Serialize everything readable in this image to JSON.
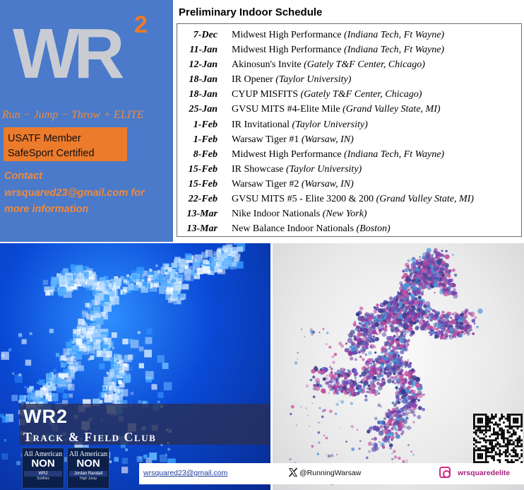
{
  "logo": {
    "letters": "WR",
    "superscript": "2"
  },
  "tagline": "Run − Jump − Throw + ELITE",
  "membership": {
    "line1": "USATF Member",
    "line2": "SafeSport Certified"
  },
  "contact": {
    "line1": "Contact",
    "line2": "wrsquared23@gmail.com for",
    "line3": "more information"
  },
  "schedule": {
    "title": "Preliminary Indoor Schedule",
    "events": [
      {
        "date": "7-Dec",
        "name": "Midwest High Performance",
        "venue": "(Indiana Tech, Ft Wayne)"
      },
      {
        "date": "11-Jan",
        "name": "Midwest High Performance",
        "venue": "(Indiana Tech, Ft Wayne)"
      },
      {
        "date": "12-Jan",
        "name": "Akinosun's Invite",
        "venue": "(Gately T&F Center, Chicago)"
      },
      {
        "date": "18-Jan",
        "name": "IR Opener",
        "venue": "(Taylor University)"
      },
      {
        "date": "18-Jan",
        "name": "CYUP MISFITS",
        "venue": "(Gately T&F Center, Chicago)"
      },
      {
        "date": "25-Jan",
        "name": "GVSU MITS #4-Elite Mile",
        "venue": "(Grand Valley State, MI)"
      },
      {
        "date": "1-Feb",
        "name": "IR Invitational",
        "venue": "(Taylor University)"
      },
      {
        "date": "1-Feb",
        "name": "Warsaw Tiger #1",
        "venue": "(Warsaw, IN)"
      },
      {
        "date": "8-Feb",
        "name": "Midwest High Performance",
        "venue": "(Indiana Tech, Ft Wayne)"
      },
      {
        "date": "15-Feb",
        "name": "IR Showcase",
        "venue": "(Taylor University)"
      },
      {
        "date": "15-Feb",
        "name": "Warsaw Tiger #2",
        "venue": "(Warsaw, IN)"
      },
      {
        "date": "22-Feb",
        "name": "GVSU MITS #5 - Elite 3200 & 200",
        "venue": "(Grand Valley State, MI)"
      },
      {
        "date": "13-Mar",
        "name": "Nike Indoor Nationals",
        "venue": "(New York)"
      },
      {
        "date": "13-Mar",
        "name": "New Balance Indoor Nationals",
        "venue": "(Boston)"
      }
    ]
  },
  "club": {
    "name": "WR2",
    "subtitle": "Track & Field Club"
  },
  "badges": [
    {
      "top": "All American",
      "mid": "NON",
      "name": "WR2",
      "sub": "SoMiles"
    },
    {
      "top": "All American",
      "mid": "NON",
      "name": "Jordan Randall",
      "sub": "High Jump"
    }
  ],
  "footer": {
    "email": "wrsquared23@gmail.com",
    "x_handle": "@RunningWarsaw",
    "instagram": "wrsquaredelite"
  },
  "icons": {
    "x": "x-logo-icon",
    "instagram": "instagram-icon",
    "qr": "qr-code"
  },
  "colors": {
    "panel_blue": "#4a7ac9",
    "accent_orange": "#ec7b2c",
    "logo_gray": "#c9ccd3"
  }
}
